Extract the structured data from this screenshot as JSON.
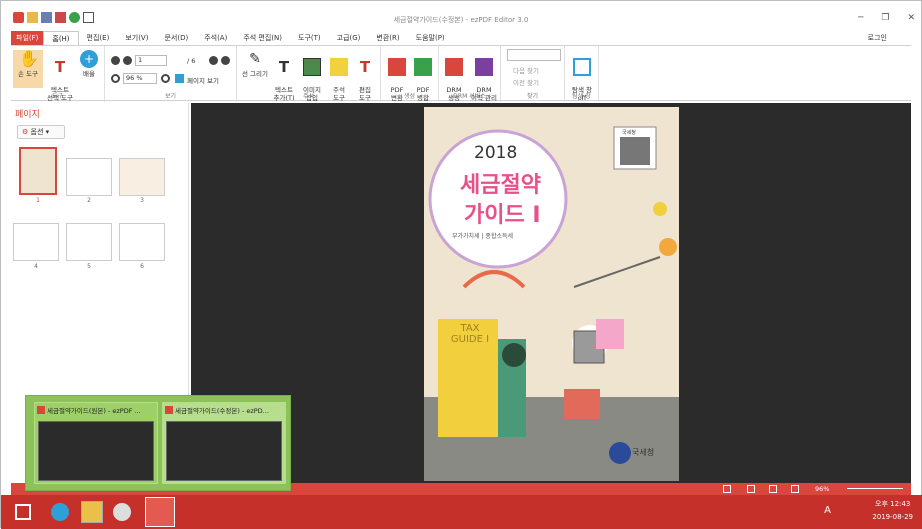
{
  "window": {
    "title": "세금절약가이드(수정본) - ezPDF Editor 3.0"
  },
  "window_controls": {
    "minimize": "─",
    "restore": "❐",
    "close": "✕"
  },
  "menu_tabs": [
    "파일(F)",
    "홈(H)",
    "편집(E)",
    "보기(V)",
    "문서(D)",
    "주석(A)",
    "주석 편집(N)",
    "도구(T)",
    "고급(G)",
    "변환(R)",
    "도움말(P)"
  ],
  "login_label": "로그인",
  "ribbon": {
    "tools": {
      "hand": "손 도구",
      "text_select": "텍스트\n선택 도구",
      "zoom": "배율",
      "group": "도구"
    },
    "view": {
      "page_input": "1",
      "page_total": "/ 6",
      "zoom_value": "96 %",
      "page_view": "페이지 보기",
      "group": "보기"
    },
    "annotate": {
      "draw_line": "선 그리기",
      "add_text": "텍스트\n추가(T)",
      "insert_image": "이미지\n삽입",
      "annot_tool": "주석\n도구",
      "edit_tool": "편집\n도구",
      "group": "주석"
    },
    "create": {
      "pdf_convert": "PDF\n변환",
      "pdf_merge": "PDF\n병합",
      "group": "생성"
    },
    "drm": {
      "drm_create": "DRM\n생성",
      "drm_manage": "DRM\n이력 관리",
      "group": "DRM 서비스"
    },
    "find": {
      "next": "다음 찾기",
      "prev": "이전 찾기",
      "group": "찾기"
    },
    "side": {
      "toggle": "탐색 창\noff",
      "group": "탐색 창"
    }
  },
  "sidebar": {
    "title": "페이지",
    "options_label": "옵션",
    "thumbnails": [
      "1",
      "2",
      "3",
      "4",
      "5",
      "6"
    ]
  },
  "cover": {
    "year": "2018",
    "title_line1": "세금절약",
    "title_line2": "가이드 I",
    "subtitle": "부가가치세 | 종합소득세",
    "book_text": "TAX\nGUIDE I",
    "publisher": "국세청",
    "qr_label": "국세청"
  },
  "previews": [
    {
      "title": "세금절약가이드(원본) - ezPDF ..."
    },
    {
      "title": "세금절약가이드(수정본) - ezPD..."
    }
  ],
  "statusbar": {
    "zoom": "96%"
  },
  "taskbar": {
    "time": "오후 12:43",
    "date": "2019-08-29",
    "ime": "A"
  },
  "colors": {
    "accent": "#d9463b",
    "taskbar": "#c5312a",
    "preview": "#8dc25a",
    "doc_bg": "#2b2b2b",
    "cover_bg": "#efe4cf"
  }
}
